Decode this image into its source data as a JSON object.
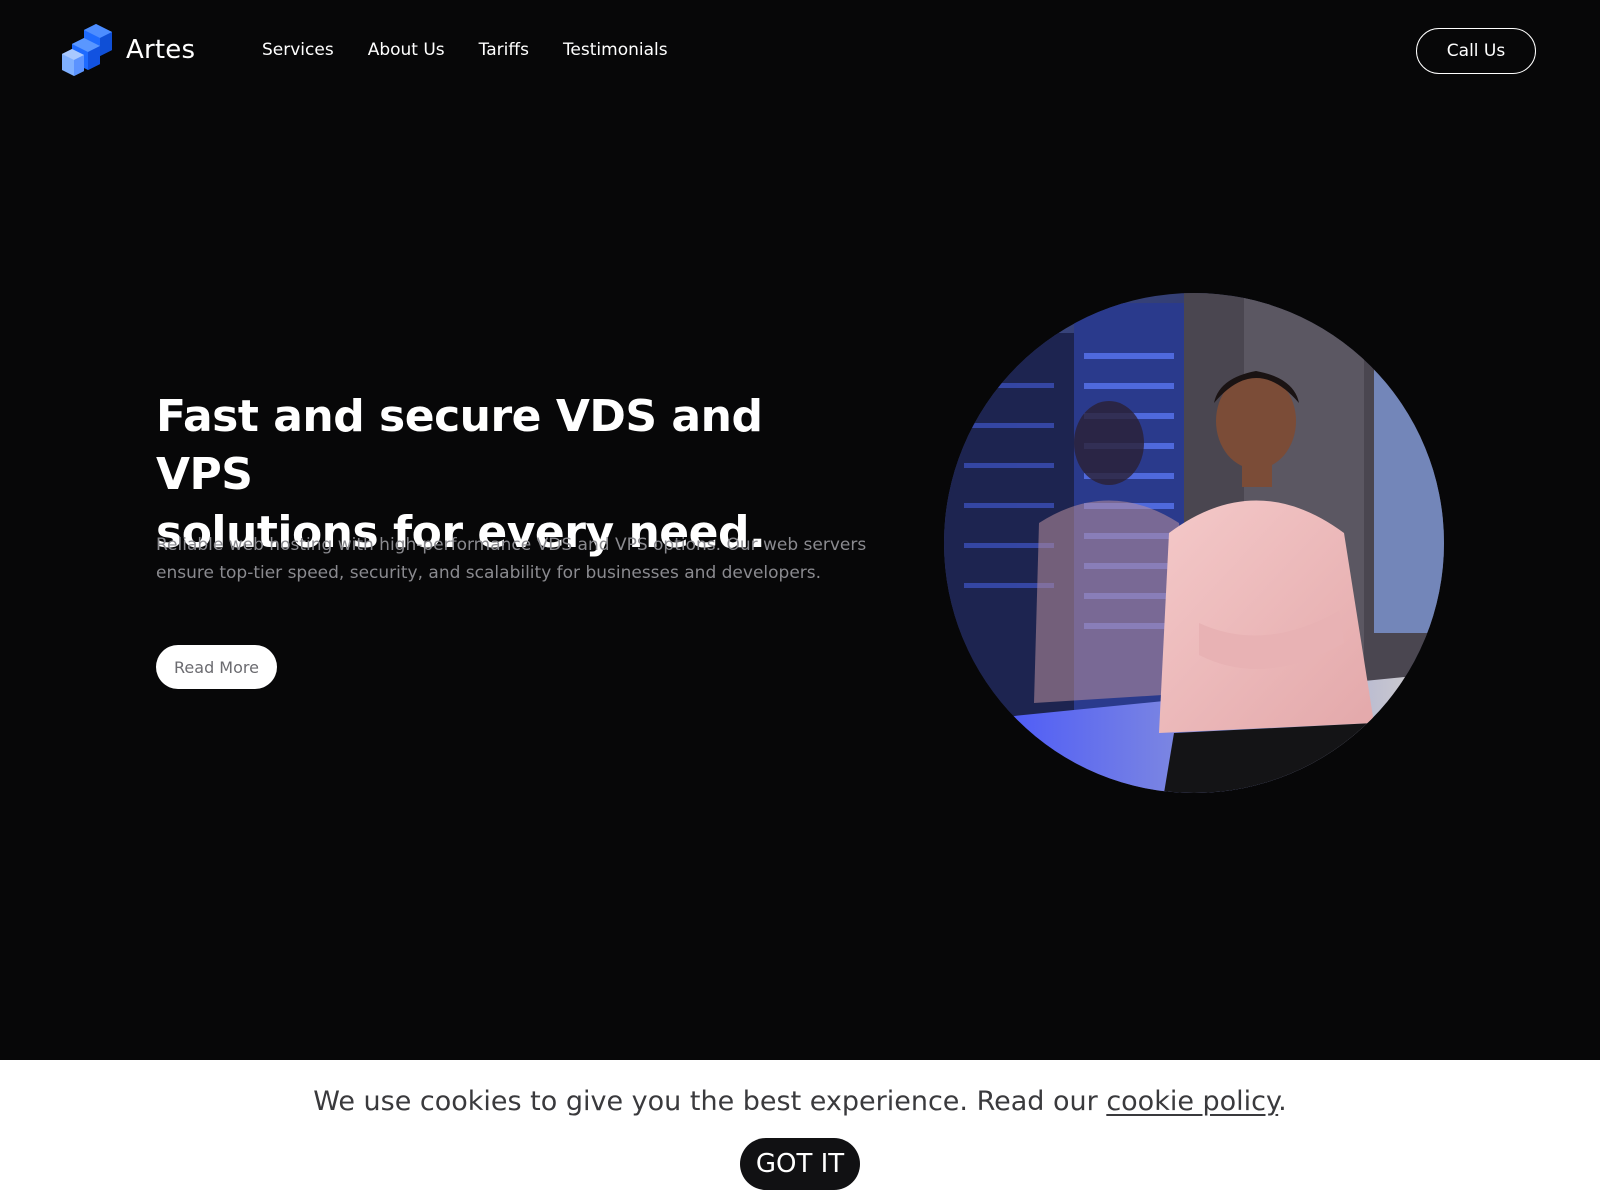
{
  "header": {
    "brand": "Artes",
    "nav": [
      {
        "label": "Services"
      },
      {
        "label": "About Us"
      },
      {
        "label": "Tariffs"
      },
      {
        "label": "Testimonials"
      }
    ],
    "cta_label": "Call Us"
  },
  "hero": {
    "title_line1": "Fast and secure VDS and VPS",
    "title_line2": "solutions for every need.",
    "description_line1": "Reliable web hosting with high-performance VDS and VPS options. Our web servers",
    "description_line2": "ensure top-tier speed, security, and scalability for businesses and developers.",
    "button_label": "Read More"
  },
  "cookie_banner": {
    "message": "We use cookies to give you the best experience. Read our ",
    "link_label": "cookie policy",
    "trailing": ".",
    "button_label": "GOT IT"
  },
  "colors": {
    "background": "#070708",
    "logo_primary": "#1e6bff",
    "logo_light": "#6fa3ff",
    "description_text": "#8a8a8f",
    "cookie_bar": "#ffffff"
  },
  "icons": {
    "logo": "isometric-blocks-icon"
  }
}
